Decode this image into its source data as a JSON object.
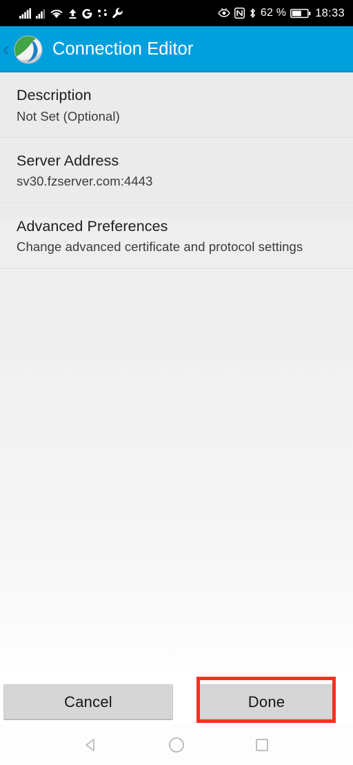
{
  "status_bar": {
    "icons_left": [
      "signal-bars-icon",
      "signal-bars-2-icon",
      "wifi-icon",
      "upload-arrow-icon",
      "google-g-icon",
      "sync-dots-icon",
      "wrench-icon"
    ],
    "icons_right": [
      "eye-off-icon",
      "nfc-icon",
      "bluetooth-icon"
    ],
    "battery_percent": "62 %",
    "battery_icon": "battery-icon",
    "clock": "18:33"
  },
  "app_bar": {
    "back_label": "‹",
    "back_icon": "back-chevron-icon",
    "logo_icon": "filezilla-logo-icon",
    "title": "Connection Editor"
  },
  "settings_list": [
    {
      "title": "Description",
      "subtitle": "Not Set (Optional)",
      "name": "description"
    },
    {
      "title": "Server Address",
      "subtitle": "sv30.fzserver.com:4443",
      "name": "server-address"
    },
    {
      "title": "Advanced Preferences",
      "subtitle": "Change advanced certificate and protocol settings",
      "name": "advanced-preferences"
    }
  ],
  "buttons": {
    "cancel_label": "Cancel",
    "done_label": "Done"
  },
  "highlight": {
    "target": "done-button",
    "color": "#f5321e"
  },
  "nav_bar": {
    "back_icon": "nav-back-triangle-icon",
    "home_icon": "nav-home-circle-icon",
    "recents_icon": "nav-recents-square-icon"
  },
  "colors": {
    "app_bar": "#00a0dd",
    "status_bar": "#000000",
    "list_bg": "#ebebeb",
    "button_bg": "#d6d6d6",
    "highlight": "#f5321e"
  }
}
